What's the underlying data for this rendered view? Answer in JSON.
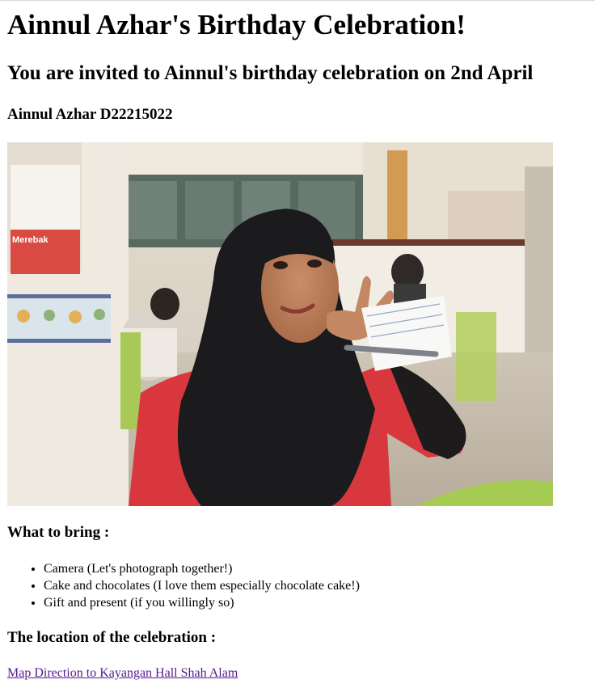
{
  "page": {
    "title": "Ainnul Azhar's Birthday Celebration!",
    "invite_heading": "You are invited to Ainnul's birthday celebration on 2nd April",
    "name_heading": "Ainnul Azhar D22215022"
  },
  "photo": {
    "alt": "Photo of Ainnul Azhar",
    "poster_text": "Merebak"
  },
  "bring": {
    "heading": "What to bring :",
    "items": [
      "Camera (Let's photograph together!)",
      "Cake and chocolates (I love them especially chocolate cake!)",
      "Gift and present (if you willingly so)"
    ]
  },
  "location": {
    "heading": "The location of the celebration :",
    "link_label": "Map Direction to Kayangan Hall Shah Alam"
  }
}
